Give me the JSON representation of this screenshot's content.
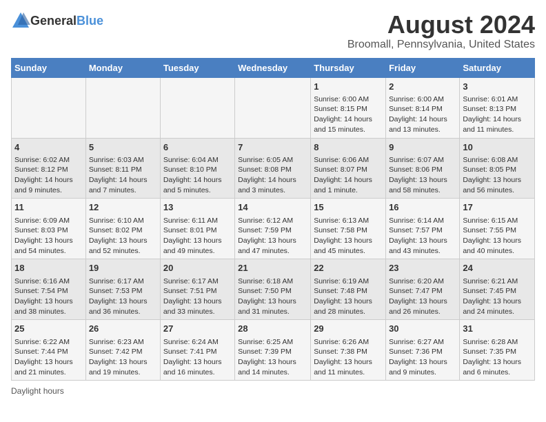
{
  "header": {
    "logo_general": "General",
    "logo_blue": "Blue",
    "title": "August 2024",
    "subtitle": "Broomall, Pennsylvania, United States"
  },
  "footer": {
    "daylight_label": "Daylight hours"
  },
  "calendar": {
    "days_of_week": [
      "Sunday",
      "Monday",
      "Tuesday",
      "Wednesday",
      "Thursday",
      "Friday",
      "Saturday"
    ],
    "weeks": [
      [
        {
          "day": "",
          "info": ""
        },
        {
          "day": "",
          "info": ""
        },
        {
          "day": "",
          "info": ""
        },
        {
          "day": "",
          "info": ""
        },
        {
          "day": "1",
          "info": "Sunrise: 6:00 AM\nSunset: 8:15 PM\nDaylight: 14 hours\nand 15 minutes."
        },
        {
          "day": "2",
          "info": "Sunrise: 6:00 AM\nSunset: 8:14 PM\nDaylight: 14 hours\nand 13 minutes."
        },
        {
          "day": "3",
          "info": "Sunrise: 6:01 AM\nSunset: 8:13 PM\nDaylight: 14 hours\nand 11 minutes."
        }
      ],
      [
        {
          "day": "4",
          "info": "Sunrise: 6:02 AM\nSunset: 8:12 PM\nDaylight: 14 hours\nand 9 minutes."
        },
        {
          "day": "5",
          "info": "Sunrise: 6:03 AM\nSunset: 8:11 PM\nDaylight: 14 hours\nand 7 minutes."
        },
        {
          "day": "6",
          "info": "Sunrise: 6:04 AM\nSunset: 8:10 PM\nDaylight: 14 hours\nand 5 minutes."
        },
        {
          "day": "7",
          "info": "Sunrise: 6:05 AM\nSunset: 8:08 PM\nDaylight: 14 hours\nand 3 minutes."
        },
        {
          "day": "8",
          "info": "Sunrise: 6:06 AM\nSunset: 8:07 PM\nDaylight: 14 hours\nand 1 minute."
        },
        {
          "day": "9",
          "info": "Sunrise: 6:07 AM\nSunset: 8:06 PM\nDaylight: 13 hours\nand 58 minutes."
        },
        {
          "day": "10",
          "info": "Sunrise: 6:08 AM\nSunset: 8:05 PM\nDaylight: 13 hours\nand 56 minutes."
        }
      ],
      [
        {
          "day": "11",
          "info": "Sunrise: 6:09 AM\nSunset: 8:03 PM\nDaylight: 13 hours\nand 54 minutes."
        },
        {
          "day": "12",
          "info": "Sunrise: 6:10 AM\nSunset: 8:02 PM\nDaylight: 13 hours\nand 52 minutes."
        },
        {
          "day": "13",
          "info": "Sunrise: 6:11 AM\nSunset: 8:01 PM\nDaylight: 13 hours\nand 49 minutes."
        },
        {
          "day": "14",
          "info": "Sunrise: 6:12 AM\nSunset: 7:59 PM\nDaylight: 13 hours\nand 47 minutes."
        },
        {
          "day": "15",
          "info": "Sunrise: 6:13 AM\nSunset: 7:58 PM\nDaylight: 13 hours\nand 45 minutes."
        },
        {
          "day": "16",
          "info": "Sunrise: 6:14 AM\nSunset: 7:57 PM\nDaylight: 13 hours\nand 43 minutes."
        },
        {
          "day": "17",
          "info": "Sunrise: 6:15 AM\nSunset: 7:55 PM\nDaylight: 13 hours\nand 40 minutes."
        }
      ],
      [
        {
          "day": "18",
          "info": "Sunrise: 6:16 AM\nSunset: 7:54 PM\nDaylight: 13 hours\nand 38 minutes."
        },
        {
          "day": "19",
          "info": "Sunrise: 6:17 AM\nSunset: 7:53 PM\nDaylight: 13 hours\nand 36 minutes."
        },
        {
          "day": "20",
          "info": "Sunrise: 6:17 AM\nSunset: 7:51 PM\nDaylight: 13 hours\nand 33 minutes."
        },
        {
          "day": "21",
          "info": "Sunrise: 6:18 AM\nSunset: 7:50 PM\nDaylight: 13 hours\nand 31 minutes."
        },
        {
          "day": "22",
          "info": "Sunrise: 6:19 AM\nSunset: 7:48 PM\nDaylight: 13 hours\nand 28 minutes."
        },
        {
          "day": "23",
          "info": "Sunrise: 6:20 AM\nSunset: 7:47 PM\nDaylight: 13 hours\nand 26 minutes."
        },
        {
          "day": "24",
          "info": "Sunrise: 6:21 AM\nSunset: 7:45 PM\nDaylight: 13 hours\nand 24 minutes."
        }
      ],
      [
        {
          "day": "25",
          "info": "Sunrise: 6:22 AM\nSunset: 7:44 PM\nDaylight: 13 hours\nand 21 minutes."
        },
        {
          "day": "26",
          "info": "Sunrise: 6:23 AM\nSunset: 7:42 PM\nDaylight: 13 hours\nand 19 minutes."
        },
        {
          "day": "27",
          "info": "Sunrise: 6:24 AM\nSunset: 7:41 PM\nDaylight: 13 hours\nand 16 minutes."
        },
        {
          "day": "28",
          "info": "Sunrise: 6:25 AM\nSunset: 7:39 PM\nDaylight: 13 hours\nand 14 minutes."
        },
        {
          "day": "29",
          "info": "Sunrise: 6:26 AM\nSunset: 7:38 PM\nDaylight: 13 hours\nand 11 minutes."
        },
        {
          "day": "30",
          "info": "Sunrise: 6:27 AM\nSunset: 7:36 PM\nDaylight: 13 hours\nand 9 minutes."
        },
        {
          "day": "31",
          "info": "Sunrise: 6:28 AM\nSunset: 7:35 PM\nDaylight: 13 hours\nand 6 minutes."
        }
      ]
    ]
  }
}
